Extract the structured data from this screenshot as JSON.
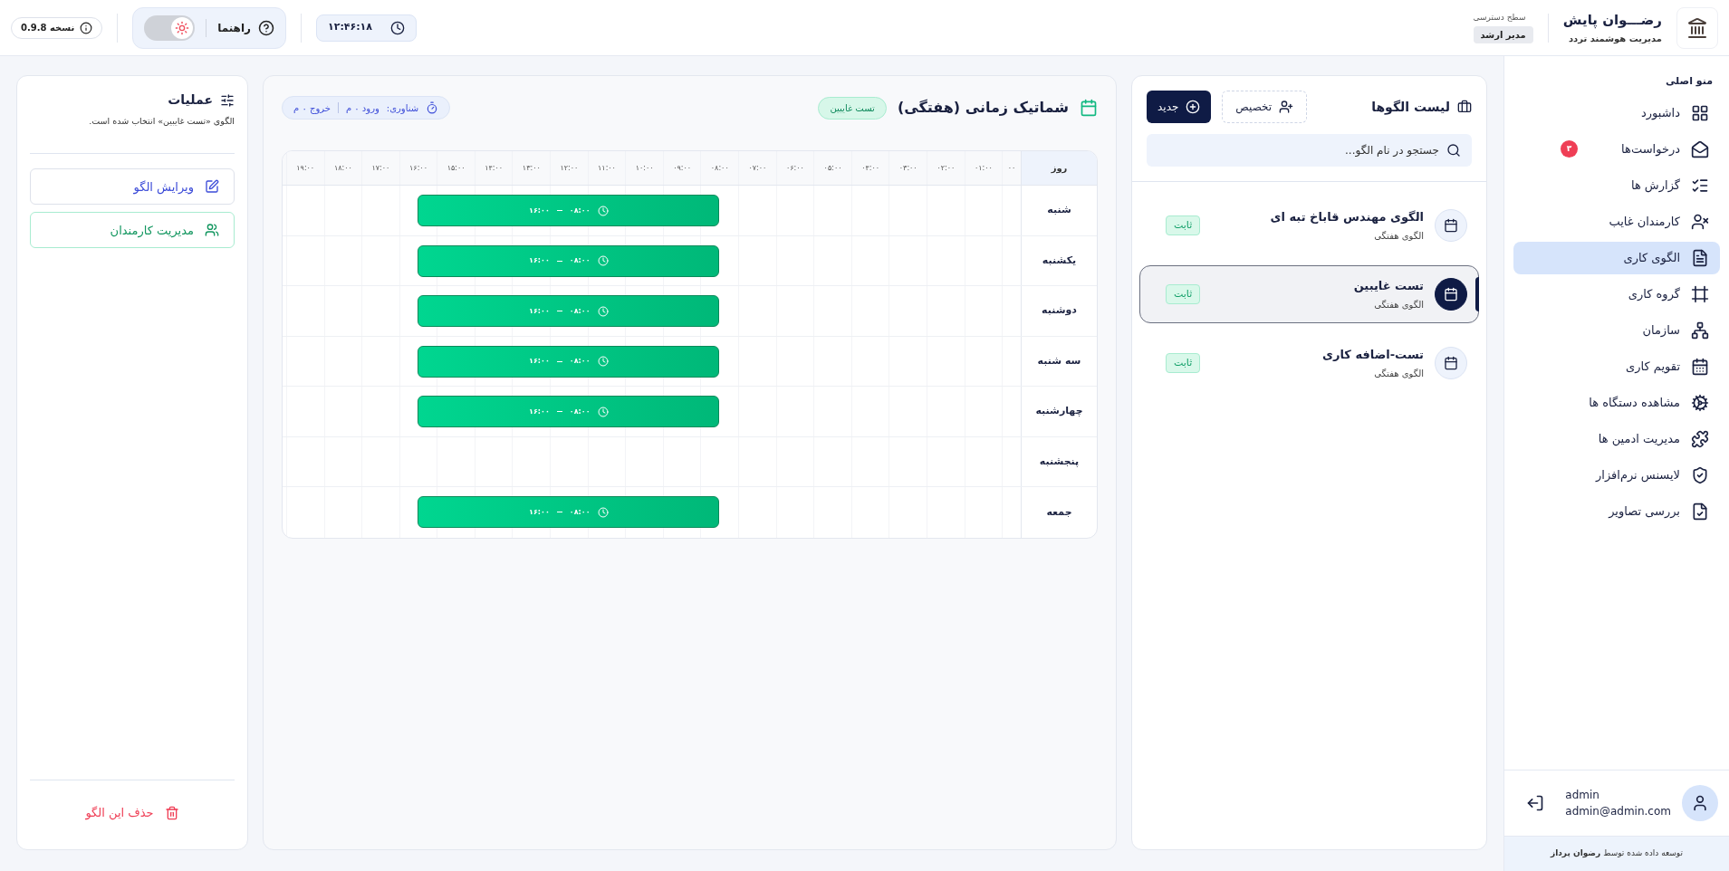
{
  "header": {
    "brand_title": "رضـــوان پایش",
    "brand_subtitle": "مدیریت هوشمند تردد",
    "access_label": "سطح دسترسی",
    "access_level": "مدیر ارشد",
    "clock": "۱۲:۴۶:۱۸",
    "help": "راهنما",
    "light_mode": true,
    "version": "نسخه 0.9.8"
  },
  "sidebar": {
    "title": "منو اصلی",
    "items": [
      {
        "label": "داشبورد",
        "selected": false
      },
      {
        "label": "درخواست‌ها",
        "selected": false,
        "badge": "۳"
      },
      {
        "label": "گزارش ها",
        "selected": false
      },
      {
        "label": "کارمندان غایب",
        "selected": false
      },
      {
        "label": "الگوی کاری",
        "selected": true
      },
      {
        "label": "گروه کاری",
        "selected": false
      },
      {
        "label": "سازمان",
        "selected": false
      },
      {
        "label": "تقویم کاری",
        "selected": false
      },
      {
        "label": "مشاهده دستگاه ها",
        "selected": false
      },
      {
        "label": "مدیریت ادمین ها",
        "selected": false
      },
      {
        "label": "لایسنس نرم‌افزار",
        "selected": false
      },
      {
        "label": "بررسی تصاویر",
        "selected": false
      }
    ],
    "user": {
      "name": "admin",
      "email": "admin@admin.com"
    },
    "footer": "توسعه داده شده توسط **رضوان پرداز**"
  },
  "patterns": {
    "title": "لیست الگوها",
    "assign_button": "تخصیص",
    "new_button": "جدید",
    "search": {
      "placeholder": "جستجو در نام الگو..."
    },
    "items": [
      {
        "name": "الگوی مهندس قاباخ تبه ای",
        "type": "الگوی هفتگی",
        "badge": "ثابت",
        "selected": false
      },
      {
        "name": "تست غایبین",
        "type": "الگوی هفتگی",
        "badge": "ثابت",
        "selected": true
      },
      {
        "name": "تست-اضافه کاری",
        "type": "الگوی هفتگی",
        "badge": "ثابت",
        "selected": false
      }
    ]
  },
  "schedule": {
    "title": "شماتیک زمانی (هفتگی)",
    "pattern_badge": "تست غایبین",
    "float_label": "شناوری:",
    "float_in": "ورود ۰ م",
    "float_out": "خروج ۰ م",
    "day_header": "روز",
    "ticks": [
      "۰۰",
      "۰۱:۰۰",
      "۰۲:۰۰",
      "۰۳:۰۰",
      "۰۴:۰۰",
      "۰۵:۰۰",
      "۰۶:۰۰",
      "۰۷:۰۰",
      "۰۸:۰۰",
      "۰۹:۰۰",
      "۱۰:۰۰",
      "۱۱:۰۰",
      "۱۲:۰۰",
      "۱۳:۰۰",
      "۱۴:۰۰",
      "۱۵:۰۰",
      "۱۶:۰۰",
      "۱۷:۰۰",
      "۱۸:۰۰",
      "۱۹:۰۰"
    ],
    "days": [
      {
        "name": "شنبه",
        "shifts": [
          {
            "start": "۰۸:۰۰",
            "end": "۱۶:۰۰"
          }
        ]
      },
      {
        "name": "یکشنبه",
        "shifts": [
          {
            "start": "۰۸:۰۰",
            "end": "۱۶:۰۰"
          }
        ]
      },
      {
        "name": "دوشنبه",
        "shifts": [
          {
            "start": "۰۸:۰۰",
            "end": "۱۶:۰۰"
          }
        ]
      },
      {
        "name": "سه شنبه",
        "shifts": [
          {
            "start": "۰۸:۰۰",
            "end": "۱۶:۰۰"
          }
        ]
      },
      {
        "name": "چهارشنبه",
        "shifts": [
          {
            "start": "۰۸:۰۰",
            "end": "۱۶:۰۰"
          }
        ]
      },
      {
        "name": "پنجشنبه"
      },
      {
        "name": "جمعه",
        "shifts": [
          {
            "start": "۰۸:۰۰",
            "end": "۱۶:۰۰"
          }
        ]
      }
    ]
  },
  "operations": {
    "title": "عملیات",
    "description": "الگوی «تست غایبین» انتخاب شده است.",
    "edit_button": "ویرایش الگو",
    "staff_button": "مدیریت کارمندان",
    "delete_button": "حذف این الگو"
  }
}
